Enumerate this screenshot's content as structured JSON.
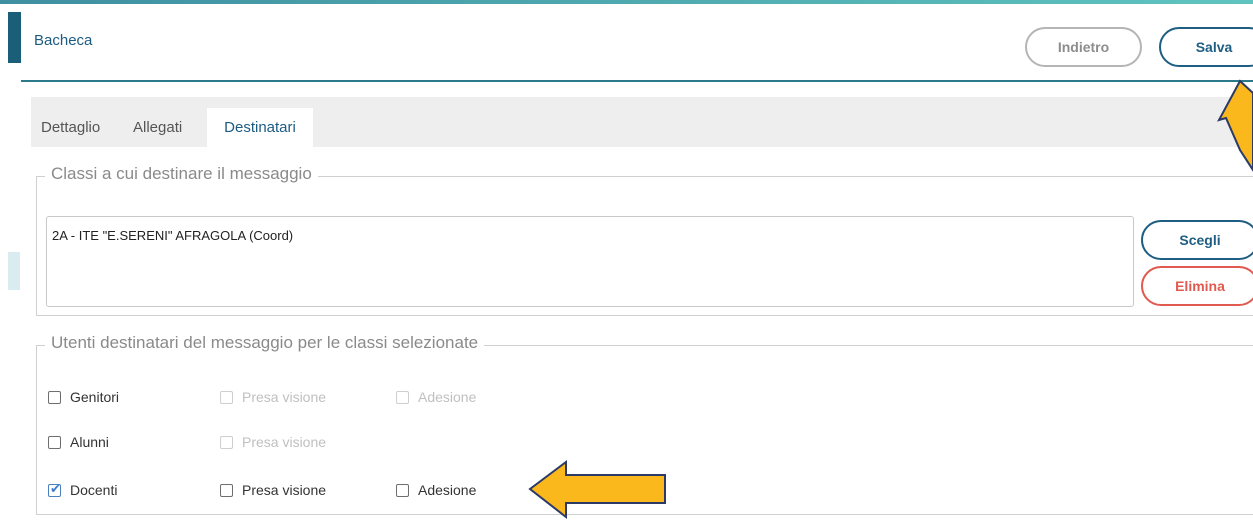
{
  "header": {
    "title": "Bacheca"
  },
  "toolbar": {
    "back_label": "Indietro",
    "save_label": "Salva"
  },
  "tabs": [
    {
      "label": "Dettaglio",
      "active": false
    },
    {
      "label": "Allegati",
      "active": false
    },
    {
      "label": "Destinatari",
      "active": true
    }
  ],
  "classes_section": {
    "legend": "Classi a cui destinare il messaggio",
    "entries": [
      "2A - ITE \"E.SERENI\" AFRAGOLA (Coord)"
    ],
    "choose_label": "Scegli",
    "delete_label": "Elimina"
  },
  "users_section": {
    "legend": "Utenti destinatari del messaggio per le classi selezionate",
    "rows": [
      {
        "label": "Genitori",
        "checked": false,
        "presa_visione": {
          "label": "Presa visione",
          "checked": false,
          "enabled": false
        },
        "adesione": {
          "label": "Adesione",
          "checked": false,
          "enabled": false
        }
      },
      {
        "label": "Alunni",
        "checked": false,
        "presa_visione": {
          "label": "Presa visione",
          "checked": false,
          "enabled": false
        }
      },
      {
        "label": "Docenti",
        "checked": true,
        "presa_visione": {
          "label": "Presa visione",
          "checked": false,
          "enabled": true
        },
        "adesione": {
          "label": "Adesione",
          "checked": false,
          "enabled": true
        }
      }
    ]
  },
  "icons": {
    "checkbox_checked": "check-icon",
    "annotation": "arrow-icon"
  },
  "colors": {
    "accent": "#1e5e82",
    "danger": "#e05a4f",
    "arrow_fill": "#fbb81c",
    "arrow_stroke": "#2b3a67"
  }
}
